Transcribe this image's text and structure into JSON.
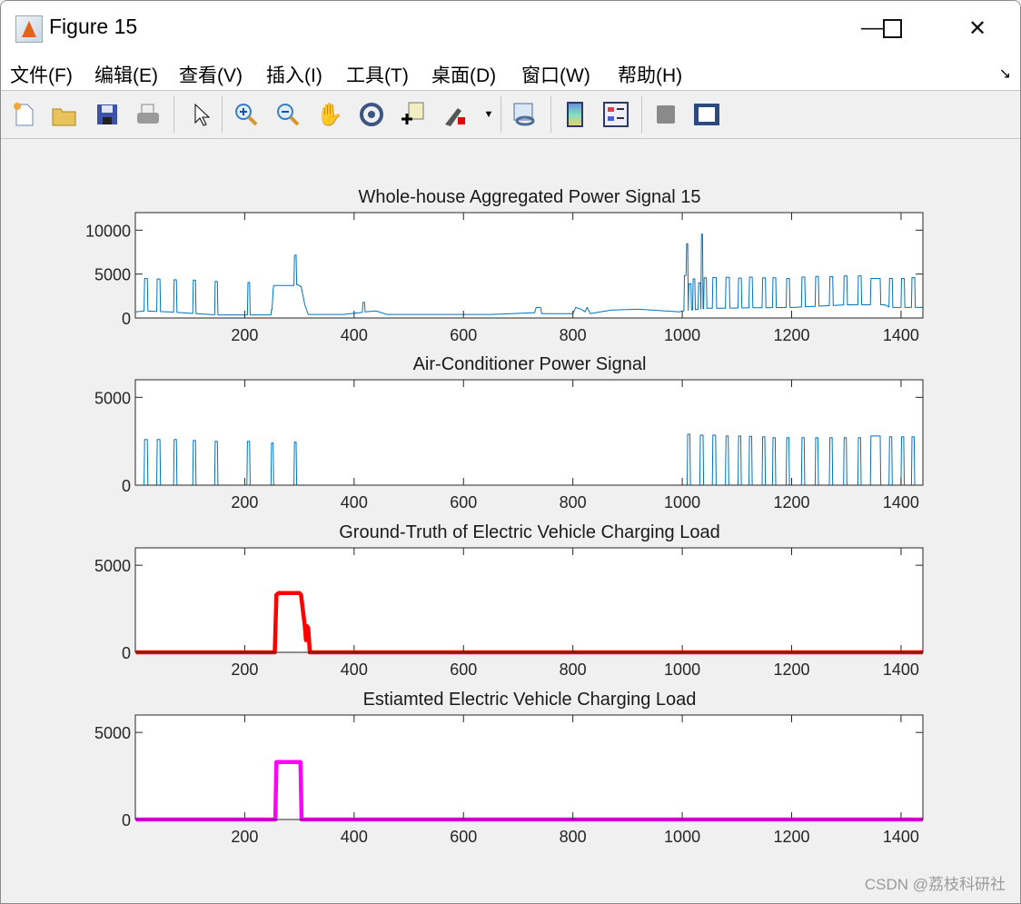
{
  "window": {
    "title": "Figure 15",
    "minimize_icon": "minimize-icon",
    "maximize_icon": "maximize-icon",
    "close_icon": "close-icon"
  },
  "menu": [
    "文件(F)",
    "编辑(E)",
    "查看(V)",
    "插入(I)",
    "工具(T)",
    "桌面(D)",
    "窗口(W)",
    "帮助(H)"
  ],
  "toolbar": [
    "new-figure-icon",
    "open-file-icon",
    "save-icon",
    "print-icon",
    "pointer-icon",
    "zoom-in-icon",
    "zoom-out-icon",
    "pan-hand-icon",
    "rotate-3d-icon",
    "data-cursor-icon",
    "brush-icon",
    "link-plot-icon",
    "colorbar-icon",
    "legend-icon",
    "hide-plot-tools-icon",
    "show-plot-tools-icon"
  ],
  "watermark": "CSDN @荔枝科研社",
  "colors": {
    "line_blue": "#0072BD",
    "ev_red": "#FF0000",
    "ev_magenta": "#FF00FF"
  },
  "chart_data": [
    {
      "type": "line",
      "title": "Whole-house Aggregated Power Signal 15",
      "xlim": [
        0,
        1440
      ],
      "ylim": [
        0,
        12000
      ],
      "xticks": [
        200,
        400,
        600,
        800,
        1000,
        1200,
        1400
      ],
      "yticks": [
        0,
        5000,
        10000
      ],
      "series": [
        {
          "name": "aggregate",
          "color": "#0072BD",
          "baseline": [
            [
              1,
              700
            ],
            [
              17,
              800
            ],
            [
              60,
              700
            ],
            [
              110,
              500
            ],
            [
              150,
              350
            ],
            [
              250,
              350
            ],
            [
              253,
              3700
            ],
            [
              290,
              3700
            ],
            [
              296,
              3800
            ],
            [
              303,
              3600
            ],
            [
              310,
              1500
            ],
            [
              316,
              400
            ],
            [
              380,
              400
            ],
            [
              410,
              600
            ],
            [
              420,
              700
            ],
            [
              440,
              800
            ],
            [
              460,
              400
            ],
            [
              650,
              400
            ],
            [
              730,
              600
            ],
            [
              733,
              1200
            ],
            [
              741,
              1200
            ],
            [
              743,
              500
            ],
            [
              800,
              500
            ],
            [
              805,
              1200
            ],
            [
              815,
              1000
            ],
            [
              822,
              700
            ],
            [
              826,
              1200
            ],
            [
              832,
              500
            ],
            [
              870,
              900
            ],
            [
              920,
              1000
            ],
            [
              995,
              700
            ],
            [
              1000,
              800
            ],
            [
              1045,
              1100
            ],
            [
              1200,
              1200
            ],
            [
              1300,
              1500
            ],
            [
              1370,
              1500
            ],
            [
              1380,
              1200
            ],
            [
              1440,
              1200
            ]
          ],
          "pulses": [
            [
              17,
              22,
              3700
            ],
            [
              40,
              45,
              3700
            ],
            [
              71,
              75,
              3700
            ],
            [
              106,
              110,
              3800
            ],
            [
              146,
              150,
              3800
            ],
            [
              206,
              209,
              3700
            ],
            [
              249,
              252,
              600
            ],
            [
              291,
              294,
              3400
            ],
            [
              416,
              419,
              1100
            ],
            [
              1004,
              1007,
              4000
            ],
            [
              1008,
              1010,
              7600
            ],
            [
              1012,
              1016,
              3000
            ],
            [
              1020,
              1023,
              3500
            ],
            [
              1030,
              1033,
              3000
            ],
            [
              1035,
              1037,
              8500
            ],
            [
              1040,
              1044,
              3500
            ],
            [
              1056,
              1062,
              3500
            ],
            [
              1080,
              1086,
              3500
            ],
            [
              1103,
              1108,
              3400
            ],
            [
              1123,
              1128,
              3500
            ],
            [
              1147,
              1152,
              3400
            ],
            [
              1166,
              1171,
              3400
            ],
            [
              1191,
              1196,
              3300
            ],
            [
              1219,
              1224,
              3400
            ],
            [
              1244,
              1249,
              3400
            ],
            [
              1270,
              1275,
              3300
            ],
            [
              1296,
              1301,
              3300
            ],
            [
              1322,
              1327,
              3300
            ],
            [
              1345,
              1362,
              3000
            ],
            [
              1379,
              1384,
              3300
            ],
            [
              1401,
              1406,
              3300
            ],
            [
              1420,
              1425,
              3400
            ]
          ]
        }
      ]
    },
    {
      "type": "line",
      "title": "Air-Conditioner Power Signal",
      "xlim": [
        0,
        1440
      ],
      "ylim": [
        0,
        6000
      ],
      "xticks": [
        200,
        400,
        600,
        800,
        1000,
        1200,
        1400
      ],
      "yticks": [
        0,
        5000
      ],
      "series": [
        {
          "name": "air-conditioner",
          "color": "#0072BD",
          "baseline": [
            [
              1,
              0
            ],
            [
              1440,
              0
            ]
          ],
          "pulses": [
            [
              17,
              22,
              2600
            ],
            [
              40,
              45,
              2600
            ],
            [
              71,
              75,
              2600
            ],
            [
              106,
              110,
              2550
            ],
            [
              146,
              150,
              2500
            ],
            [
              205,
              209,
              2500
            ],
            [
              249,
              252,
              2400
            ],
            [
              291,
              294,
              2450
            ],
            [
              1010,
              1014,
              2900
            ],
            [
              1033,
              1038,
              2850
            ],
            [
              1056,
              1061,
              2850
            ],
            [
              1080,
              1084,
              2800
            ],
            [
              1103,
              1107,
              2800
            ],
            [
              1123,
              1127,
              2780
            ],
            [
              1147,
              1151,
              2750
            ],
            [
              1166,
              1170,
              2700
            ],
            [
              1191,
              1195,
              2700
            ],
            [
              1219,
              1223,
              2700
            ],
            [
              1244,
              1248,
              2700
            ],
            [
              1270,
              1274,
              2700
            ],
            [
              1296,
              1300,
              2700
            ],
            [
              1322,
              1326,
              2700
            ],
            [
              1345,
              1362,
              2800
            ],
            [
              1379,
              1383,
              2750
            ],
            [
              1401,
              1405,
              2750
            ],
            [
              1420,
              1424,
              2750
            ]
          ]
        }
      ]
    },
    {
      "type": "line",
      "title": "Ground-Truth of Electric Vehicle Charging Load",
      "xlim": [
        0,
        1440
      ],
      "ylim": [
        0,
        6000
      ],
      "xticks": [
        200,
        400,
        600,
        800,
        1000,
        1200,
        1400
      ],
      "yticks": [
        0,
        5000
      ],
      "series": [
        {
          "name": "ev-ground-truth",
          "color": "#FF0000",
          "baseline": [
            [
              1,
              0
            ],
            [
              255,
              0
            ],
            [
              258,
              3300
            ],
            [
              262,
              3400
            ],
            [
              300,
              3400
            ],
            [
              303,
              3300
            ],
            [
              310,
              1500
            ],
            [
              312,
              700
            ],
            [
              314,
              1500
            ],
            [
              316,
              1400
            ],
            [
              319,
              0
            ],
            [
              1440,
              0
            ]
          ],
          "pulses": []
        }
      ]
    },
    {
      "type": "line",
      "title": "Estiamted Electric Vehicle Charging Load",
      "xlim": [
        0,
        1440
      ],
      "ylim": [
        0,
        6000
      ],
      "xticks": [
        200,
        400,
        600,
        800,
        1000,
        1200,
        1400
      ],
      "yticks": [
        0,
        5000
      ],
      "series": [
        {
          "name": "ev-estimated",
          "color": "#FF00FF",
          "baseline": [
            [
              1,
              0
            ],
            [
              256,
              0
            ],
            [
              258,
              3300
            ],
            [
              302,
              3300
            ],
            [
              304,
              0
            ],
            [
              1440,
              0
            ]
          ],
          "pulses": []
        }
      ]
    }
  ]
}
